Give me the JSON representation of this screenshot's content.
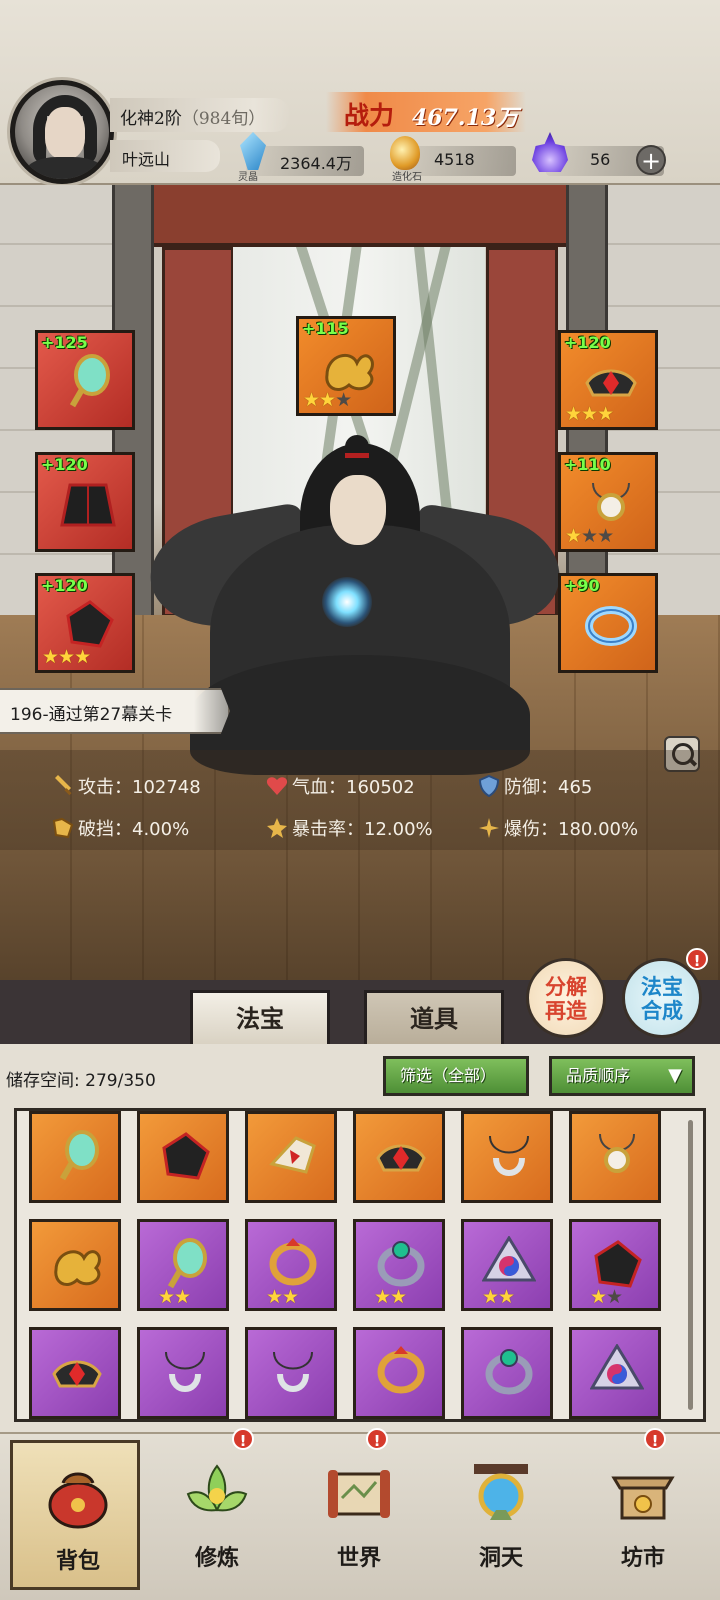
{
  "player": {
    "rank": "化神2阶",
    "rank_sub": "（984旬）",
    "name": "叶远山",
    "power_label": "战力",
    "power_value": "467.13万"
  },
  "currencies": [
    {
      "label": "灵晶",
      "value": "2364.4万",
      "icon": "blue-crystal-icon"
    },
    {
      "label": "造化石",
      "value": "4518",
      "icon": "gold-stone-icon"
    },
    {
      "label": "",
      "value": "56",
      "icon": "purple-flame-icon"
    }
  ],
  "equipment": {
    "left": [
      {
        "bonus": "+125",
        "stars": 0,
        "icon": "jade-mirror-icon",
        "color": "#e35a4b"
      },
      {
        "bonus": "+120",
        "stars": 0,
        "icon": "dark-robe-icon",
        "color": "#e35a4b"
      },
      {
        "bonus": "+120",
        "stars": 3,
        "icon": "black-boots-icon",
        "color": "#f28c2b"
      }
    ],
    "center": {
      "bonus": "+115",
      "stars": 2,
      "icon": "golden-cloud-talisman-icon",
      "color": "#f28c2b"
    },
    "right": [
      {
        "bonus": "+120",
        "stars": 3,
        "icon": "ruby-crown-icon",
        "color": "#f28c2b"
      },
      {
        "bonus": "+110",
        "stars": 1,
        "icon": "pearl-pendant-icon",
        "color": "#f28c2b"
      },
      {
        "bonus": "+90",
        "stars": 0,
        "icon": "ice-bracelet-icon",
        "color": "#f28c2b"
      }
    ]
  },
  "stage": "196-通过第27幕关卡",
  "stats": [
    {
      "label": "攻击",
      "value": "102748",
      "icon": "sword-icon"
    },
    {
      "label": "气血",
      "value": "160502",
      "icon": "heart-icon"
    },
    {
      "label": "防御",
      "value": "465",
      "icon": "shield-icon"
    },
    {
      "label": "破挡",
      "value": "4.00%",
      "icon": "break-icon"
    },
    {
      "label": "暴击率",
      "value": "12.00%",
      "icon": "crit-icon"
    },
    {
      "label": "爆伤",
      "value": "180.00%",
      "icon": "crit-damage-icon"
    }
  ],
  "tabs": {
    "treasure": "法宝",
    "items": "道具"
  },
  "actions": {
    "decompose_l1": "分解",
    "decompose_l2": "再造",
    "merge_l1": "法宝",
    "merge_l2": "合成",
    "badge": "!"
  },
  "inventory": {
    "storage_label": "储存空间:",
    "storage_value": "279/350",
    "filter_label": "筛选（全部）",
    "sort_label": "品质顺序",
    "items": [
      {
        "rarity": "orange",
        "icon": "jade-mirror-icon",
        "stars": 0
      },
      {
        "rarity": "orange",
        "icon": "black-boots-icon",
        "stars": 0
      },
      {
        "rarity": "orange",
        "icon": "winged-gauntlet-icon",
        "stars": 0
      },
      {
        "rarity": "orange",
        "icon": "ruby-crown-icon",
        "stars": 0
      },
      {
        "rarity": "orange",
        "icon": "silver-necklace-icon",
        "stars": 0
      },
      {
        "rarity": "orange",
        "icon": "pearl-pendant-icon",
        "stars": 0
      },
      {
        "rarity": "orange",
        "icon": "golden-cloud-talisman-icon",
        "stars": 0
      },
      {
        "rarity": "purple",
        "icon": "jade-mirror-icon",
        "stars": 2
      },
      {
        "rarity": "purple",
        "icon": "fire-ring-icon",
        "stars": 2
      },
      {
        "rarity": "purple",
        "icon": "emerald-ring-icon",
        "stars": 2
      },
      {
        "rarity": "purple",
        "icon": "yin-yang-star-icon",
        "stars": 2
      },
      {
        "rarity": "purple",
        "icon": "black-boots-icon",
        "stars": 1
      },
      {
        "rarity": "purple",
        "icon": "ruby-crown-icon",
        "stars": 0
      },
      {
        "rarity": "purple",
        "icon": "silver-necklace-icon",
        "stars": 0
      },
      {
        "rarity": "purple",
        "icon": "silver-necklace-icon",
        "stars": 0
      },
      {
        "rarity": "purple",
        "icon": "fire-ring-icon",
        "stars": 0
      },
      {
        "rarity": "purple",
        "icon": "emerald-ring-icon",
        "stars": 0
      },
      {
        "rarity": "purple",
        "icon": "yin-yang-star-icon",
        "stars": 0
      }
    ]
  },
  "nav": [
    {
      "label": "背包",
      "icon": "bag-icon",
      "badge": false
    },
    {
      "label": "修炼",
      "icon": "lotus-icon",
      "badge": true
    },
    {
      "label": "世界",
      "icon": "scroll-map-icon",
      "badge": true
    },
    {
      "label": "洞天",
      "icon": "portal-icon",
      "badge": false
    },
    {
      "label": "坊市",
      "icon": "market-icon",
      "badge": true
    }
  ]
}
